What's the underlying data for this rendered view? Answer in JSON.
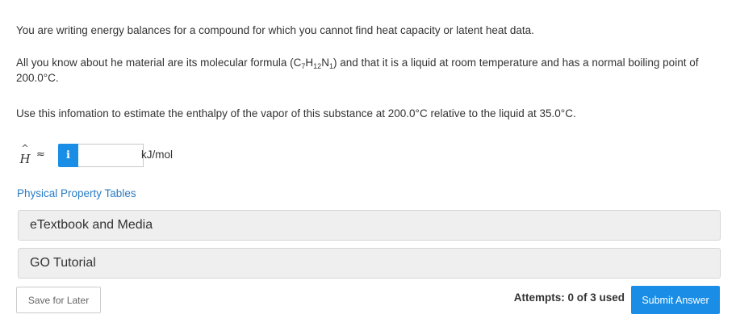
{
  "question": {
    "intro": "You are writing energy balances for a compound for which you cannot find heat capacity or latent heat data.",
    "given_before": "All you know about he material are its molecular formula (",
    "formula": [
      {
        "el": "C",
        "n": "7"
      },
      {
        "el": "H",
        "n": "12"
      },
      {
        "el": "N",
        "n": "1"
      }
    ],
    "given_after": ") and that it is a liquid at room temperature and has a normal boiling point of 200.0°C.",
    "task": "Use this infomation to estimate the enthalpy of the vapor of this substance at 200.0°C relative to the liquid at 35.0°C."
  },
  "answer": {
    "symbol": "H",
    "hat": "^",
    "approx": "≈",
    "info_icon": "info-icon",
    "info_label": "i",
    "value": "",
    "unit": "kJ/mol"
  },
  "links": {
    "physical_property_tables": "Physical Property Tables"
  },
  "resources": [
    {
      "label": "eTextbook and Media"
    },
    {
      "label": "GO Tutorial"
    }
  ],
  "footer": {
    "save_label": "Save for Later",
    "attempts": "Attempts: 0 of 3 used",
    "submit_label": "Submit Answer"
  },
  "colors": {
    "accent": "#1a8ee6",
    "link": "#2a7bc4",
    "panel": "#efefef"
  }
}
